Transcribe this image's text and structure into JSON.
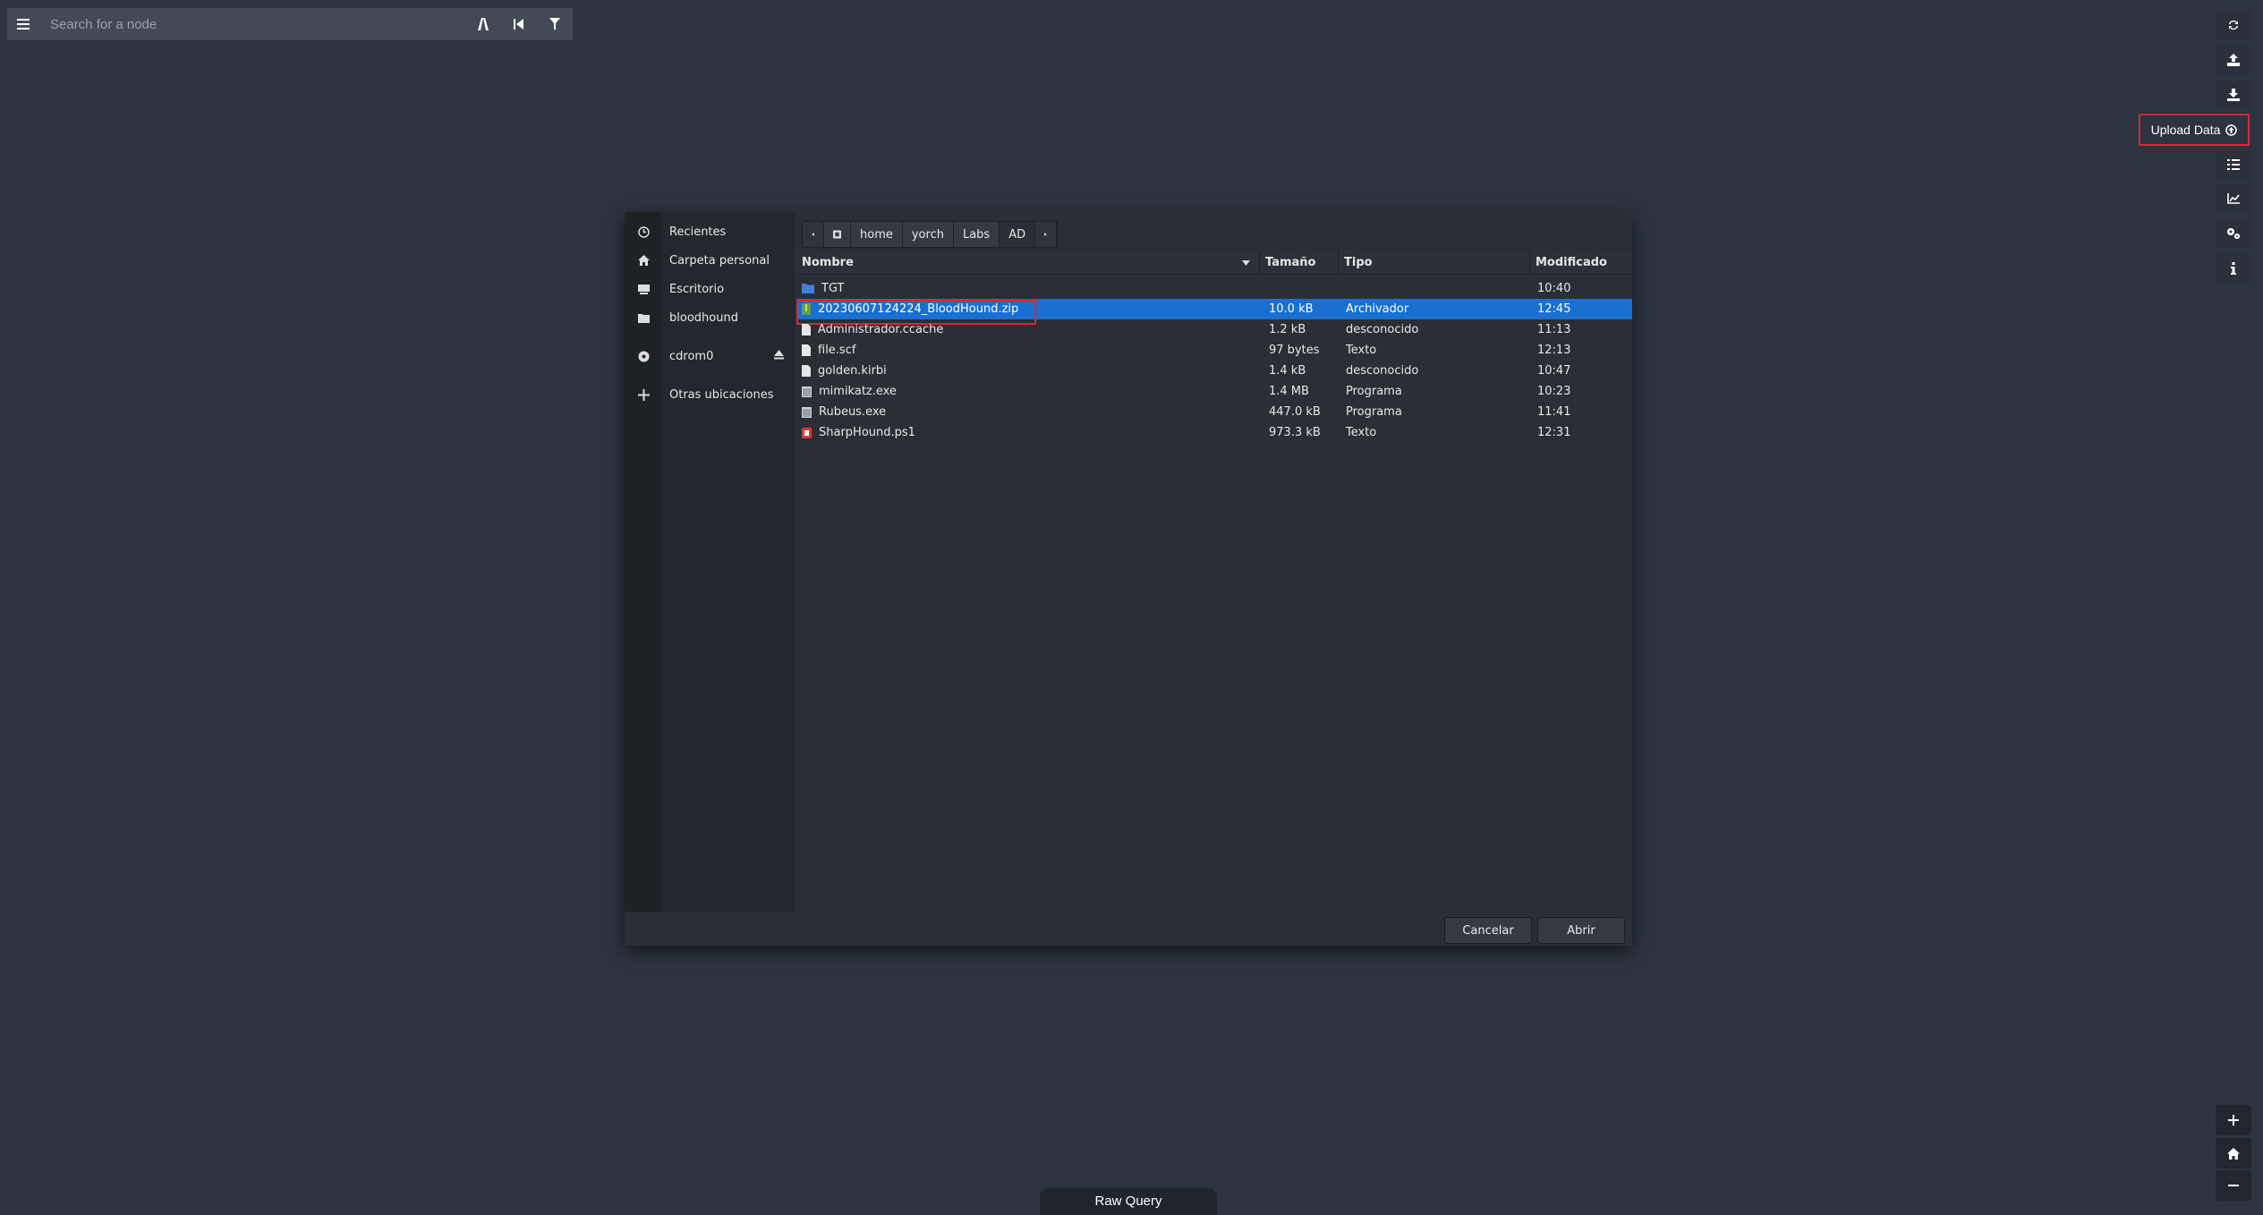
{
  "search": {
    "placeholder": "Search for a node"
  },
  "toolbar": {
    "icons": [
      "refresh-icon",
      "upload-icon",
      "download-icon",
      "list-icon",
      "chart-icon",
      "settings-icon",
      "info-icon"
    ],
    "upload_tooltip": "Upload Data"
  },
  "raw_query": {
    "label": "Raw Query"
  },
  "dialog": {
    "places": [
      {
        "label": "Recientes",
        "icon": "clock-icon"
      },
      {
        "label": "Carpeta personal",
        "icon": "home-icon"
      },
      {
        "label": "Escritorio",
        "icon": "desktop-icon"
      },
      {
        "label": "bloodhound",
        "icon": "folder-icon"
      },
      {
        "label": "cdrom0",
        "icon": "disc-icon"
      },
      {
        "label": "Otras ubicaciones",
        "icon": "plus-icon"
      }
    ],
    "path": [
      "home",
      "yorch",
      "Labs",
      "AD"
    ],
    "columns": {
      "name": "Nombre",
      "size": "Tamaño",
      "type": "Tipo",
      "modified": "Modificado"
    },
    "files": [
      {
        "name": "TGT",
        "size": "",
        "type": "",
        "modified": "10:40",
        "icon": "folder"
      },
      {
        "name": "20230607124224_BloodHound.zip",
        "size": "10.0 kB",
        "type": "Archivador",
        "modified": "12:45",
        "icon": "zip",
        "selected": true
      },
      {
        "name": "Administrador.ccache",
        "size": "1.2 kB",
        "type": "desconocido",
        "modified": "11:13",
        "icon": "file"
      },
      {
        "name": "file.scf",
        "size": "97 bytes",
        "type": "Texto",
        "modified": "12:13",
        "icon": "file"
      },
      {
        "name": "golden.kirbi",
        "size": "1.4 kB",
        "type": "desconocido",
        "modified": "10:47",
        "icon": "file"
      },
      {
        "name": "mimikatz.exe",
        "size": "1.4 MB",
        "type": "Programa",
        "modified": "10:23",
        "icon": "exe"
      },
      {
        "name": "Rubeus.exe",
        "size": "447.0 kB",
        "type": "Programa",
        "modified": "11:41",
        "icon": "exe"
      },
      {
        "name": "SharpHound.ps1",
        "size": "973.3 kB",
        "type": "Texto",
        "modified": "12:31",
        "icon": "script"
      }
    ],
    "cancel_label": "Cancelar",
    "open_label": "Abrir"
  },
  "zoom": {
    "icons": [
      "zoom-in-icon",
      "home-view-icon",
      "zoom-out-icon"
    ]
  }
}
